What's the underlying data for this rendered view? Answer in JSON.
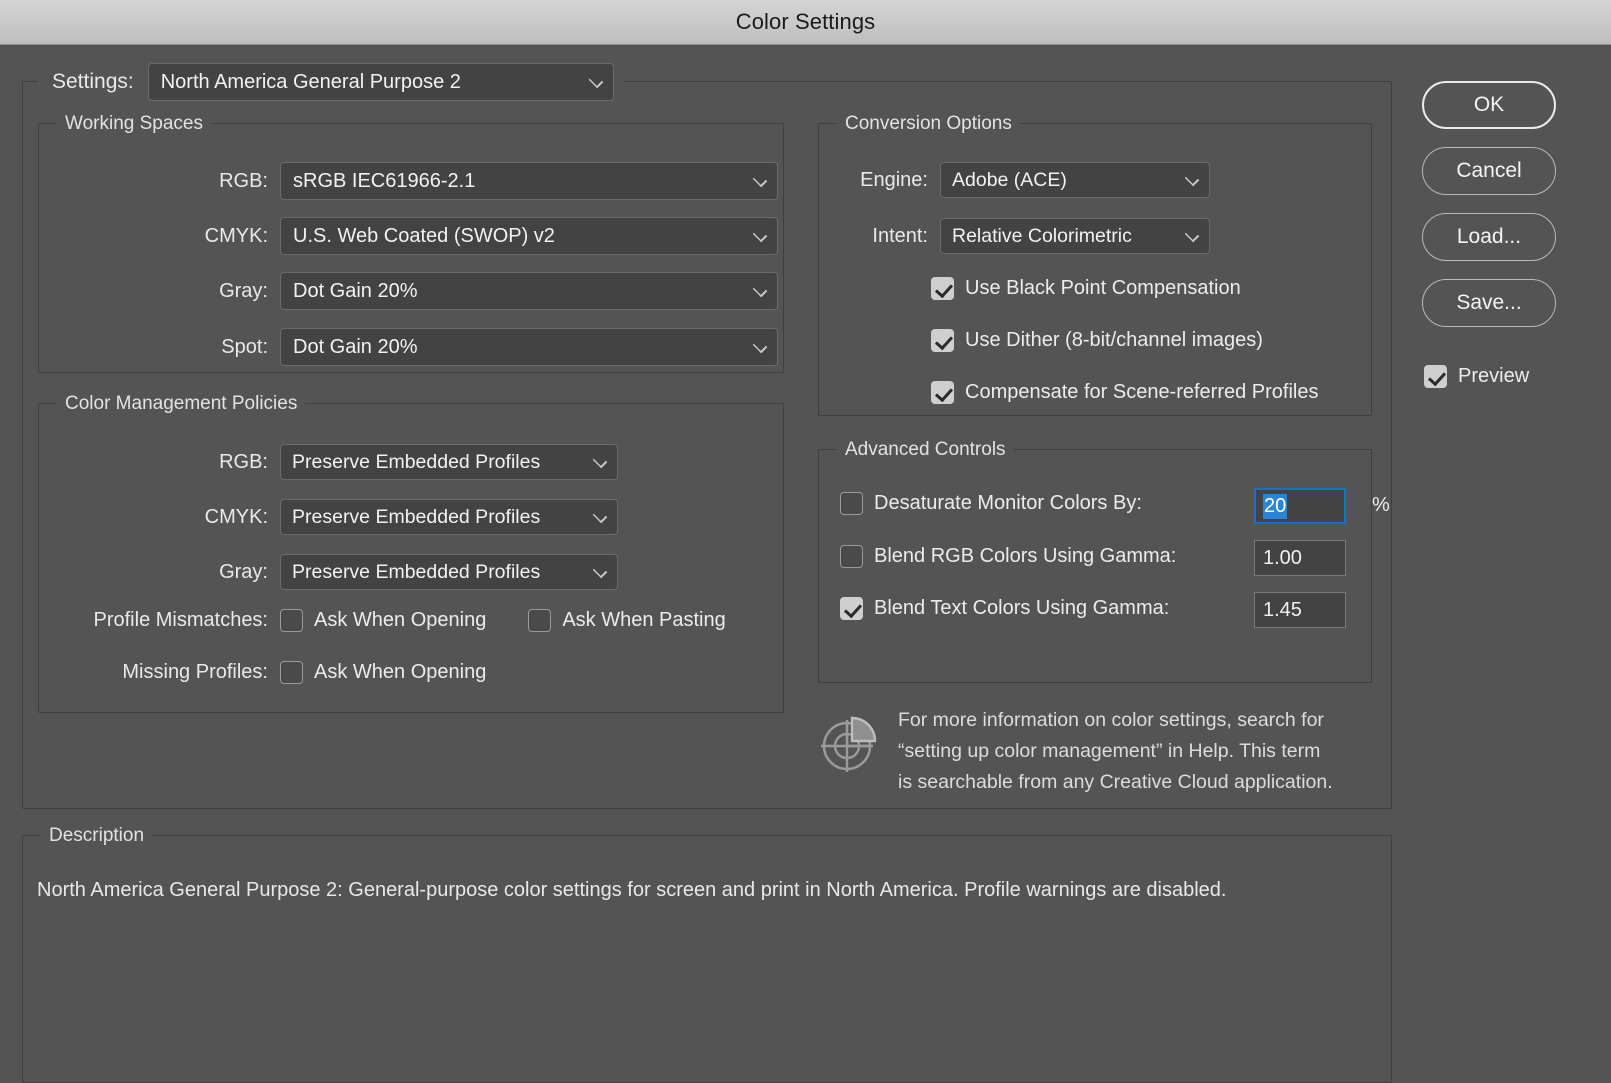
{
  "window": {
    "title": "Color Settings"
  },
  "settings": {
    "label": "Settings:",
    "value": "North America General Purpose 2"
  },
  "working_spaces": {
    "legend": "Working Spaces",
    "rows": [
      {
        "label": "RGB:",
        "value": "sRGB IEC61966-2.1"
      },
      {
        "label": "CMYK:",
        "value": "U.S. Web Coated (SWOP) v2"
      },
      {
        "label": "Gray:",
        "value": "Dot Gain 20%"
      },
      {
        "label": "Spot:",
        "value": "Dot Gain 20%"
      }
    ]
  },
  "color_management_policies": {
    "legend": "Color Management Policies",
    "rows": [
      {
        "label": "RGB:",
        "value": "Preserve Embedded Profiles"
      },
      {
        "label": "CMYK:",
        "value": "Preserve Embedded Profiles"
      },
      {
        "label": "Gray:",
        "value": "Preserve Embedded Profiles"
      }
    ],
    "profile_mismatches": {
      "label": "Profile Mismatches:",
      "ask_when_opening": {
        "label": "Ask When Opening",
        "checked": false
      },
      "ask_when_pasting": {
        "label": "Ask When Pasting",
        "checked": false
      }
    },
    "missing_profiles": {
      "label": "Missing Profiles:",
      "ask_when_opening": {
        "label": "Ask When Opening",
        "checked": false
      }
    }
  },
  "conversion_options": {
    "legend": "Conversion Options",
    "engine": {
      "label": "Engine:",
      "value": "Adobe (ACE)"
    },
    "intent": {
      "label": "Intent:",
      "value": "Relative Colorimetric"
    },
    "checkboxes": [
      {
        "label": "Use Black Point Compensation",
        "checked": true
      },
      {
        "label": "Use Dither (8-bit/channel images)",
        "checked": true
      },
      {
        "label": "Compensate for Scene-referred Profiles",
        "checked": true
      }
    ]
  },
  "advanced_controls": {
    "legend": "Advanced Controls",
    "rows": [
      {
        "label": "Desaturate Monitor Colors By:",
        "checked": false,
        "value": "20",
        "unit": "%",
        "focused": true
      },
      {
        "label": "Blend RGB Colors Using Gamma:",
        "checked": false,
        "value": "1.00",
        "unit": "",
        "focused": false
      },
      {
        "label": "Blend Text Colors Using Gamma:",
        "checked": true,
        "value": "1.45",
        "unit": "",
        "focused": false
      }
    ]
  },
  "info": {
    "icon": "color-wheel-icon",
    "text": "For more information on color settings, search for\n“setting up color management” in Help. This term\nis searchable from any Creative Cloud application."
  },
  "buttons": {
    "ok": "OK",
    "cancel": "Cancel",
    "load": "Load...",
    "save": "Save...",
    "preview": {
      "label": "Preview",
      "checked": true
    }
  },
  "description": {
    "legend": "Description",
    "text": "North America General Purpose 2:  General-purpose color settings for screen and print in North America. Profile warnings are disabled."
  },
  "colors": {
    "dialog_bg": "#545454",
    "titlebar_bg": "#c9c9c9",
    "field_bg": "#434343",
    "accent_focus": "#1473c8",
    "accent_selection": "#2a86d4",
    "text": "#ececec"
  }
}
